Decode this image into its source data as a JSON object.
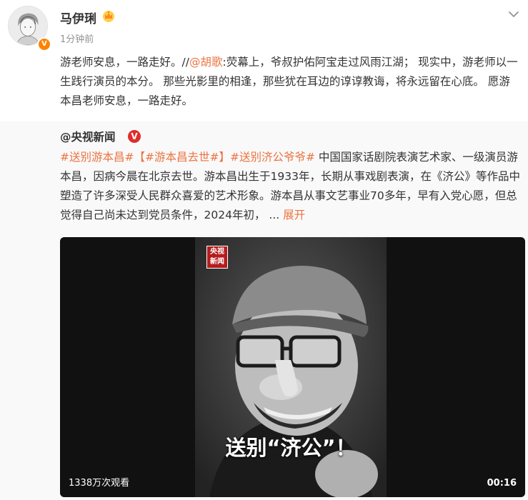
{
  "post": {
    "user_name": "马伊琍",
    "time": "1分钟前",
    "text": {
      "before_mention": "游老师安息，一路走好。//",
      "mention": "@胡歌",
      "after_mention": ":荧幕上，爷叔护佑阿宝走过风雨江湖； 现实中，游老师以一生践行演员的本分。 那些光影里的相逢，那些犹在耳边的谆谆教诲，将永远留在心底。 愿游本昌老师安息，一路走好。"
    }
  },
  "repost": {
    "author": "@央视新闻",
    "tags": [
      "#送别游本昌#",
      "【#游本昌去世#】",
      "#送别济公爷爷#"
    ],
    "body": " 中国国家话剧院表演艺术家、一级演员游本昌，因病今晨在北京去世。游本昌出生于1933年，长期从事戏剧表演，在《济公》等作品中塑造了许多深受人民群众喜爱的艺术形象。游本昌从事文艺事业70多年，早有入党心愿，但总觉得自己尚未达到党员条件，2024年初，",
    "ellipsis": " ... ",
    "expand_label": "展开"
  },
  "video": {
    "logo_line1": "央视",
    "logo_line2": "新闻",
    "caption": "送别“济公”！",
    "views": "1338万次观看",
    "duration": "00:16"
  },
  "icons": {
    "verified": "verified-badge-icon",
    "crown": "crown-icon",
    "menu": "chevron-down-icon"
  },
  "colors": {
    "accent": "#eb7340",
    "verified_orange": "#ff8200",
    "verified_red": "#e02d2d",
    "repost_bg": "#f9f9f9"
  }
}
